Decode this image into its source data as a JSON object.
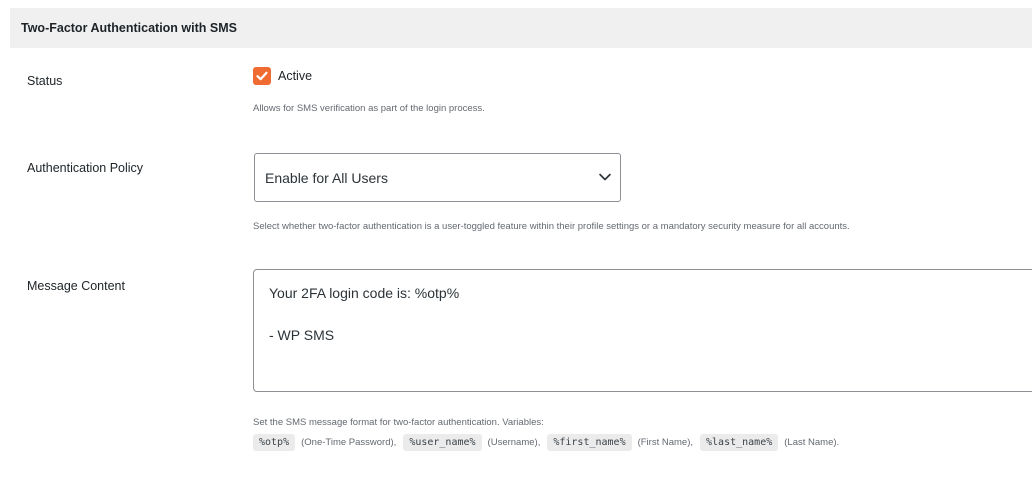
{
  "section": {
    "title": "Two-Factor Authentication with SMS"
  },
  "status": {
    "label": "Status",
    "checkbox_label": "Active",
    "checked": true,
    "help": "Allows for SMS verification as part of the login process."
  },
  "policy": {
    "label": "Authentication Policy",
    "selected": "Enable for All Users",
    "help": "Select whether two-factor authentication is a user-toggled feature within their profile settings or a mandatory security measure for all accounts."
  },
  "message": {
    "label": "Message Content",
    "lines": [
      "Your 2FA login code is: %otp%",
      "",
      "- WP SMS"
    ],
    "help": "Set the SMS message format for two-factor authentication. Variables:",
    "variables": [
      {
        "code": "%otp%",
        "desc": "(One-Time Password),"
      },
      {
        "code": "%user_name%",
        "desc": "(Username),"
      },
      {
        "code": "%first_name%",
        "desc": "(First Name),"
      },
      {
        "code": "%last_name%",
        "desc": "(Last Name)."
      }
    ]
  },
  "colors": {
    "accent": "#f06b32",
    "header_bg": "#f0f0f1",
    "help_text": "#646970"
  },
  "icons": {
    "checkbox": "checkmark-icon",
    "select": "chevron-down-icon"
  }
}
